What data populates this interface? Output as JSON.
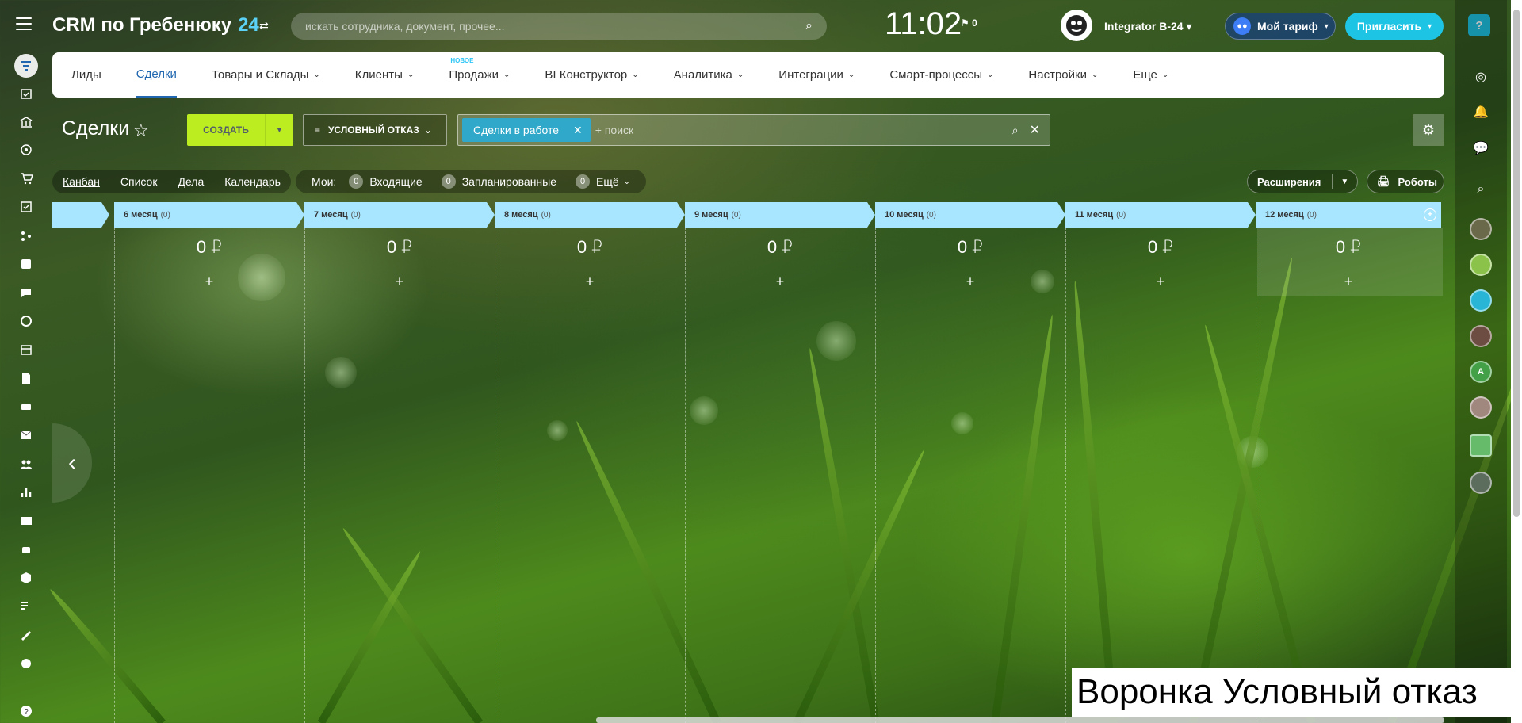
{
  "header": {
    "logo_text": "CRM по Гребенюку",
    "logo_num": "24",
    "search_placeholder": "искать сотрудника, документ, прочее...",
    "time": "11:02",
    "flag_count": "0",
    "user_name": "Integrator B-24",
    "tariff_label": "Мой тариф",
    "invite_label": "Пригласить",
    "help_label": "?"
  },
  "nav": {
    "items": [
      "Лиды",
      "Сделки",
      "Товары и Склады",
      "Клиенты",
      "Продажи",
      "BI Конструктор",
      "Аналитика",
      "Интеграции",
      "Смарт-процессы",
      "Настройки",
      "Еще"
    ],
    "active": "Сделки",
    "new_badge": "НОВОЕ"
  },
  "toolbar": {
    "page_title": "Сделки",
    "create_label": "СОЗДАТЬ",
    "filter_label": "УСЛОВНЫЙ ОТКАЗ",
    "filter_chip": "Сделки в работе",
    "search_placeholder": "+ поиск"
  },
  "views": {
    "items": [
      "Канбан",
      "Список",
      "Дела",
      "Календарь"
    ],
    "active": "Канбан",
    "my_label": "Мои:",
    "counters": [
      {
        "count": "0",
        "label": "Входящие"
      },
      {
        "count": "0",
        "label": "Запланированные"
      },
      {
        "count": "0",
        "label": "Ещё"
      }
    ],
    "extensions_label": "Расширения",
    "robots_label": "Роботы"
  },
  "kanban": {
    "columns": [
      {
        "title": "6 месяц",
        "count": "(0)",
        "sum": "0 ₽",
        "add": "+"
      },
      {
        "title": "7 месяц",
        "count": "(0)",
        "sum": "0 ₽",
        "add": "+"
      },
      {
        "title": "8 месяц",
        "count": "(0)",
        "sum": "0 ₽",
        "add": "+"
      },
      {
        "title": "9 месяц",
        "count": "(0)",
        "sum": "0 ₽",
        "add": "+"
      },
      {
        "title": "10 месяц",
        "count": "(0)",
        "sum": "0 ₽",
        "add": "+"
      },
      {
        "title": "11 месяц",
        "count": "(0)",
        "sum": "0 ₽",
        "add": "+"
      },
      {
        "title": "12 месяц",
        "count": "(0)",
        "sum": "0 ₽",
        "add": "+"
      }
    ],
    "column_color": "#a8e6ff"
  },
  "rightbar": {
    "letter_avatar": "A"
  },
  "caption": "Воронка Условный отказ",
  "colors": {
    "accent": "#2067b0",
    "create": "#bbed21",
    "invite": "#1ec4e4",
    "chip": "#2fa8c9"
  }
}
